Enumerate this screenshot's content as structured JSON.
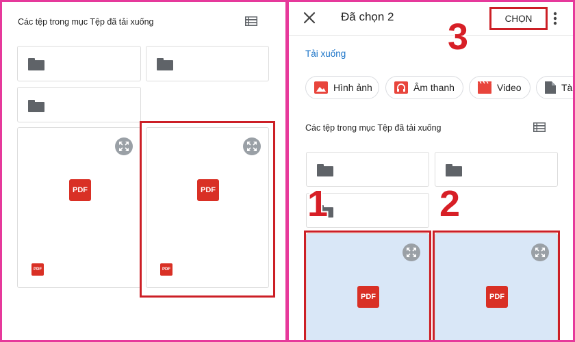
{
  "left_panel": {
    "section_label": "Các tệp trong mục Tệp đã tải xuống",
    "pdf_label": "PDF"
  },
  "right_panel": {
    "title": "Đã chọn 2",
    "select_button": "CHỌN",
    "downloads_link": "Tải xuống",
    "filter_chips": [
      {
        "label": "Hình ảnh",
        "icon": "image-icon"
      },
      {
        "label": "Âm thanh",
        "icon": "headphones-icon"
      },
      {
        "label": "Video",
        "icon": "video-icon"
      },
      {
        "label": "Tà",
        "icon": "document-icon"
      }
    ],
    "section_label": "Các tệp trong mục Tệp đã tải xuống",
    "pdf_label": "PDF"
  },
  "annotations": {
    "step_1": "1",
    "step_2": "2",
    "step_3": "3"
  },
  "colors": {
    "frame": "#e6399b",
    "highlight_red": "#cc1f26",
    "pdf_red": "#d93025",
    "selected_card": "#d9e7f7",
    "link_blue": "#1a73c8",
    "icon_gray": "#5f6368"
  }
}
